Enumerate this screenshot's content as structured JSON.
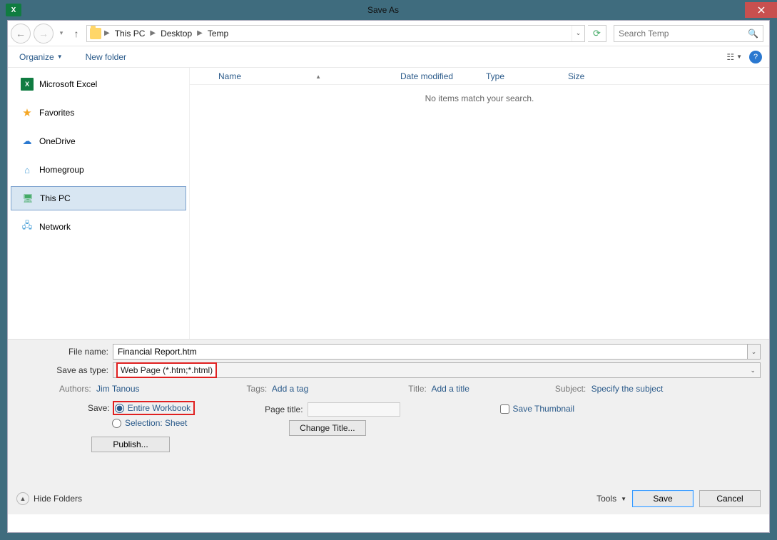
{
  "window": {
    "title": "Save As"
  },
  "nav": {
    "path": [
      "This PC",
      "Desktop",
      "Temp"
    ],
    "search_placeholder": "Search Temp"
  },
  "toolbar": {
    "organize": "Organize",
    "new_folder": "New folder"
  },
  "sidebar": {
    "items": [
      {
        "icon": "excel",
        "label": "Microsoft Excel"
      },
      {
        "icon": "star",
        "label": "Favorites"
      },
      {
        "icon": "cloud",
        "label": "OneDrive"
      },
      {
        "icon": "home",
        "label": "Homegroup"
      },
      {
        "icon": "pc",
        "label": "This PC",
        "selected": true
      },
      {
        "icon": "net",
        "label": "Network"
      }
    ]
  },
  "columns": {
    "name": "Name",
    "date": "Date modified",
    "type": "Type",
    "size": "Size"
  },
  "empty_message": "No items match your search.",
  "form": {
    "file_name_label": "File name:",
    "file_name": "Financial Report.htm",
    "save_type_label": "Save as type:",
    "save_type": "Web Page (*.htm;*.html)",
    "authors_label": "Authors:",
    "authors": "Jim Tanous",
    "tags_label": "Tags:",
    "tags": "Add a tag",
    "title_label": "Title:",
    "title": "Add a title",
    "subject_label": "Subject:",
    "subject": "Specify the subject",
    "save_label": "Save:",
    "entire_workbook": "Entire Workbook",
    "selection_sheet": "Selection: Sheet",
    "publish": "Publish...",
    "page_title_label": "Page title:",
    "change_title": "Change Title...",
    "save_thumbnail": "Save Thumbnail"
  },
  "footer": {
    "hide_folders": "Hide Folders",
    "tools": "Tools",
    "save": "Save",
    "cancel": "Cancel"
  }
}
